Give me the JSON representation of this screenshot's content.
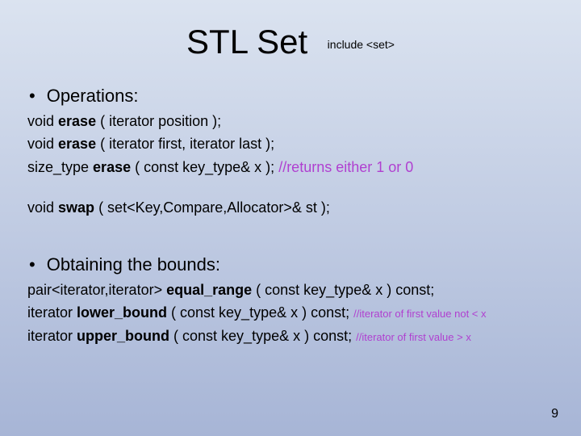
{
  "title": "STL Set",
  "subtitle": "include <set>",
  "sections": {
    "ops_heading": "Operations:",
    "erase1_a": "void ",
    "erase1_b": "erase",
    "erase1_c": " ( iterator position );",
    "erase2_a": "void ",
    "erase2_b": "erase",
    "erase2_c": " ( iterator first, iterator last );",
    "erase3_a": "size_type ",
    "erase3_b": "erase",
    "erase3_c": " ( const key_type& x );   ",
    "erase3_d": "//returns either 1 or 0",
    "swap_a": "void ",
    "swap_b": "swap",
    "swap_c": " ( set<Key,Compare,Allocator>& st );",
    "bounds_heading": "Obtaining the bounds:",
    "eq_a": "pair<iterator,iterator> ",
    "eq_b": "equal_range",
    "eq_c": " ( const key_type& x ) const;",
    "lb_a": "iterator ",
    "lb_b": "lower_bound",
    "lb_c": " ( const key_type& x ) const; ",
    "lb_d": "//iterator of first value not < x",
    "ub_a": "iterator ",
    "ub_b": "upper_bound",
    "ub_c": " ( const key_type& x ) const; ",
    "ub_d": "//iterator of first value > x"
  },
  "pagenum": "9"
}
